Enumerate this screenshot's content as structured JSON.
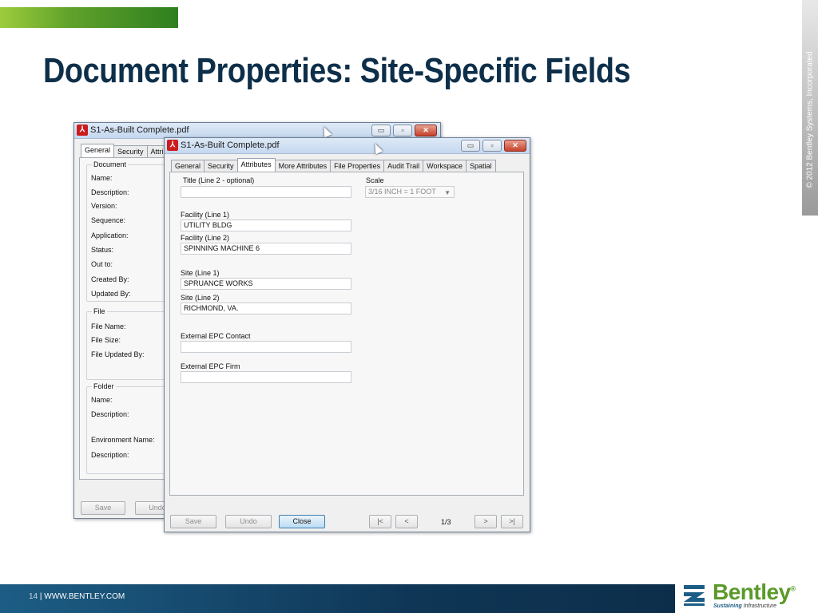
{
  "slide": {
    "title": "Document Properties: Site-Specific Fields",
    "side_copyright": "© 2012 Bentley Systems, Incorporated",
    "footer_page": "14",
    "footer_sep": " | ",
    "footer_url": "WWW.BENTLEY.COM",
    "logo_word": "Bentley",
    "logo_trademark": "®",
    "logo_tagline_bold": "Sustaining",
    "logo_tagline_rest": " Infrastructure",
    "brand_green": "#5a9a2a",
    "brand_navy": "#0d2f4a"
  },
  "back_window": {
    "title": "S1-As-Built Complete.pdf",
    "pdf_icon": "pdf-icon",
    "tabs": [
      "General",
      "Security",
      "Attrib"
    ],
    "active_tab": "General",
    "document_group": "Document",
    "document_labels": [
      "Name:",
      "Description:",
      "Version:",
      "Sequence:",
      "Application:",
      "Status:",
      "Out to:",
      "Created By:",
      "Updated By:"
    ],
    "file_group": "File",
    "file_labels": [
      "File Name:",
      "File Size:",
      "File Updated By:"
    ],
    "folder_group": "Folder",
    "folder_labels": [
      "Name:",
      "Description:",
      "Environment Name:",
      "Description:"
    ],
    "save_label": "Save",
    "undo_label": "Undo"
  },
  "front_window": {
    "title": "S1-As-Built Complete.pdf",
    "tabs": [
      "General",
      "Security",
      "Attributes",
      "More Attributes",
      "File Properties",
      "Audit Trail",
      "Workspace",
      "Spatial"
    ],
    "active_tab": "Attributes",
    "fields": {
      "title2_label": "Title (Line 2 - optional)",
      "title2_value": "",
      "scale_label": "Scale",
      "scale_value": "3/16 INCH = 1 FOOT",
      "facility1_label": "Facility (Line 1)",
      "facility1_value": "UTILITY BLDG",
      "facility2_label": "Facility (Line 2)",
      "facility2_value": "SPINNING MACHINE 6",
      "site1_label": "Site (Line 1)",
      "site1_value": "SPRUANCE WORKS",
      "site2_label": "Site (Line 2)",
      "site2_value": "RICHMOND, VA.",
      "epc_contact_label": "External EPC Contact",
      "epc_contact_value": "",
      "epc_firm_label": "External EPC Firm",
      "epc_firm_value": ""
    },
    "save_label": "Save",
    "undo_label": "Undo",
    "close_label": "Close",
    "first_label": "|<",
    "prev_label": "<",
    "page_indicator": "1/3",
    "next_label": ">",
    "last_label": ">|"
  }
}
